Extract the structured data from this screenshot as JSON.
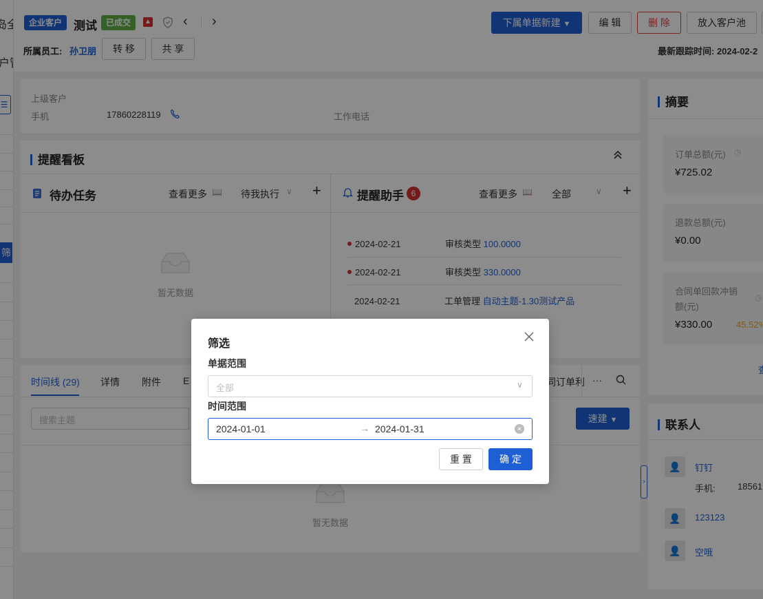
{
  "leftbar": {
    "frag1": "岛全",
    "frag2": "户管",
    "filter_label": "筛"
  },
  "header": {
    "tag_enterprise": "企业客户",
    "customer_name": "测试",
    "tag_deal": "已成交",
    "owner_label": "所属员工:",
    "owner_name": "孙卫朋",
    "transfer_label": "转 移",
    "share_label": "共 享",
    "new_sub_label": "下属单据新建",
    "edit_label": "编 辑",
    "delete_label": "删 除",
    "pool_label": "放入客户池",
    "latest_follow": "最新跟踪时间: 2024-02-2"
  },
  "info": {
    "parent_label": "上级客户",
    "phone_label": "手机",
    "phone_value": "17860228119",
    "work_phone_label": "工作电话"
  },
  "board": {
    "title": "提醒看板",
    "todo": {
      "title": "待办任务",
      "more": "查看更多",
      "filter": "待我执行",
      "empty": "暂无数据"
    },
    "reminder": {
      "title": "提醒助手",
      "badge": "6",
      "more": "查看更多",
      "filter": "全部",
      "rows": [
        {
          "date": "2024-02-21",
          "type": "审核类型",
          "value": "100.0000"
        },
        {
          "date": "2024-02-21",
          "type": "审核类型",
          "value": "330.0000"
        },
        {
          "date": "2024-02-21",
          "type": "工单管理",
          "value": "自动主题-1.30测试产品"
        }
      ]
    }
  },
  "timeline": {
    "tabs": [
      "时间线 (29)",
      "详情",
      "附件",
      "E",
      "同订单利"
    ],
    "more": "···",
    "search_placeholder": "搜索主题",
    "quick_create": "速建",
    "empty": "暂无数据"
  },
  "summary": {
    "title": "摘要",
    "order_total_label": "订单总额(元)",
    "order_total": "¥725.02",
    "refund_label": "退款总额(元)",
    "refund": "¥0.00",
    "contract_label_1": "合同单回款冲销",
    "contract_label_2": "额(元)",
    "contract_value": "¥330.00",
    "contract_pct": "45.52%",
    "more": "查"
  },
  "contacts": {
    "title": "联系人",
    "items": [
      {
        "name": "钉钉",
        "phone_label": "手机:",
        "phone": "18561"
      },
      {
        "name": "123123"
      },
      {
        "name": "空哦"
      }
    ]
  },
  "modal": {
    "title": "筛选",
    "scope_label": "单据范围",
    "scope_placeholder": "全部",
    "time_label": "时间范围",
    "date_start": "2024-01-01",
    "date_arrow": "→",
    "date_end": "2024-01-31",
    "reset_label": "重 置",
    "confirm_label": "确 定"
  },
  "colors": {
    "primary": "#1f5fd6",
    "danger": "#e03c3c",
    "deal_green": "#5fad48",
    "orange": "#f0a020"
  }
}
